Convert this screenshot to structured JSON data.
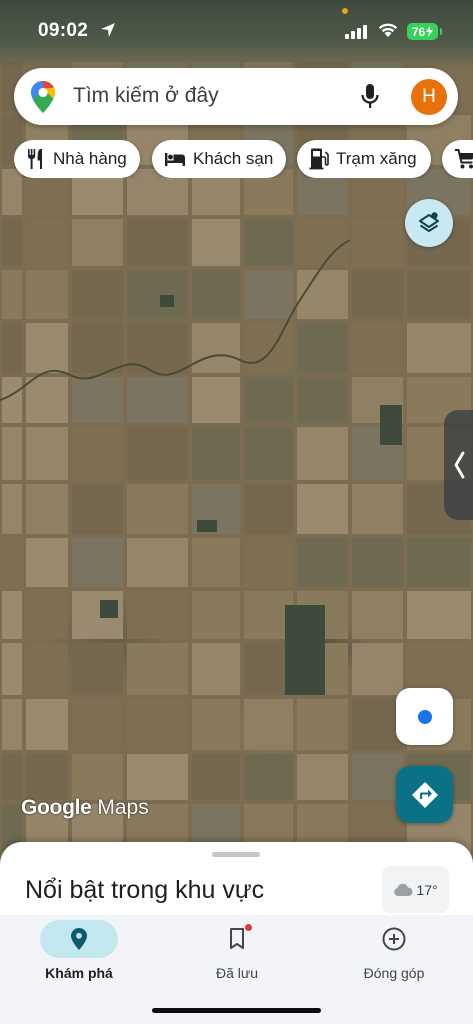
{
  "status_bar": {
    "time": "09:02",
    "battery": "76"
  },
  "search": {
    "placeholder": "Tìm kiếm ở đây",
    "avatar_letter": "H"
  },
  "chips": [
    {
      "label": "Nhà hàng",
      "icon": "restaurant-icon"
    },
    {
      "label": "Khách sạn",
      "icon": "hotel-icon"
    },
    {
      "label": "Trạm xăng",
      "icon": "gas-station-icon"
    },
    {
      "label": "",
      "icon": "shopping-cart-icon"
    }
  ],
  "map": {
    "watermark_brand": "Google",
    "watermark_product": "Maps"
  },
  "sheet": {
    "title": "Nổi bật trong khu vực",
    "weather": "17°"
  },
  "nav": [
    {
      "label": "Khám phá",
      "icon": "explore-pin-icon",
      "active": true
    },
    {
      "label": "Đã lưu",
      "icon": "bookmark-icon",
      "active": false
    },
    {
      "label": "Đóng góp",
      "icon": "add-circle-icon",
      "active": false
    }
  ],
  "colors": {
    "accent": "#0b7285",
    "active_nav": "#c2e7ef",
    "locate": "#1a73e8",
    "avatar": "#e8710a"
  }
}
